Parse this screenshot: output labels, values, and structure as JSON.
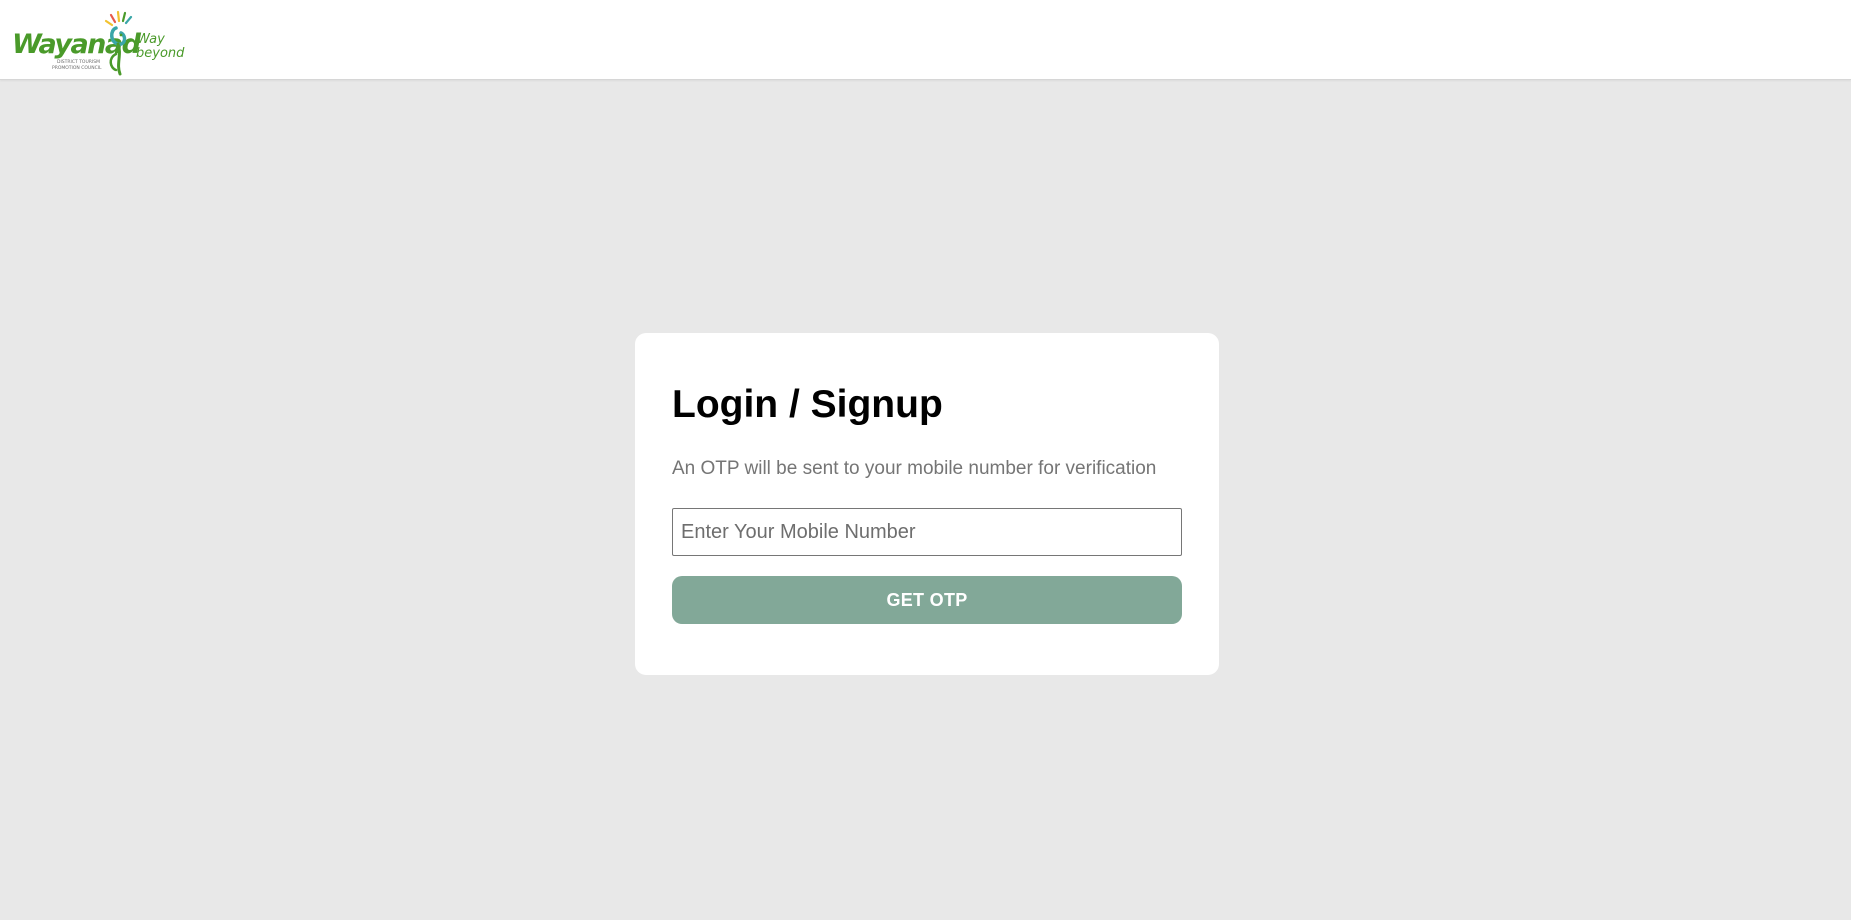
{
  "header": {
    "logo": {
      "name": "Wayanad",
      "tagline": "Way beyond",
      "caption_line1": "DISTRICT TOURISM",
      "caption_line2": "PROMOTION COUNCIL",
      "colors": {
        "wordmark": "#4a9a2a",
        "accent_teal": "#3aa6a8",
        "accent_yellow": "#f2c230",
        "accent_red": "#e85a4a"
      }
    }
  },
  "login_card": {
    "title": "Login / Signup",
    "subtitle": "An OTP will be sent to your mobile number for verification",
    "mobile_input": {
      "placeholder": "Enter Your Mobile Number",
      "value": ""
    },
    "submit_label": "GET OTP"
  },
  "colors": {
    "page_background": "#e8e8e8",
    "card_background": "#ffffff",
    "button_background": "#82a898",
    "subtitle_text": "#757575"
  }
}
